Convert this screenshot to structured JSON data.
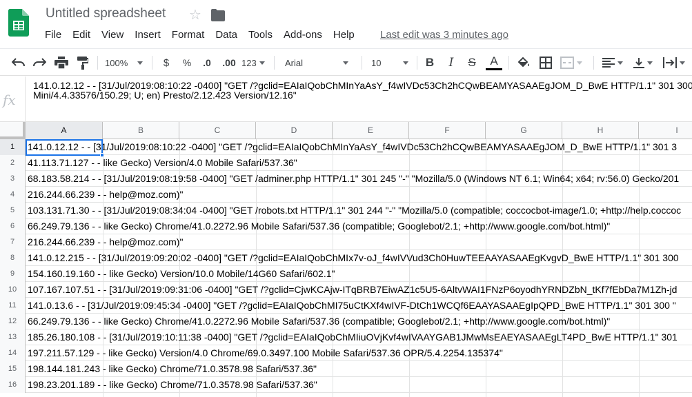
{
  "app": {
    "title": "Untitled spreadsheet",
    "last_edit": "Last edit was 3 minutes ago",
    "brand_color": "#0f9d58"
  },
  "menu": [
    "File",
    "Edit",
    "View",
    "Insert",
    "Format",
    "Data",
    "Tools",
    "Add-ons",
    "Help"
  ],
  "toolbar": {
    "zoom": "100%",
    "currency": "$",
    "percent": "%",
    "decimal_decrease": ".0",
    "decimal_increase": ".00",
    "number_format": "123",
    "font": "Arial",
    "font_size": "10",
    "bold": "B",
    "italic": "I",
    "strikethrough": "S",
    "text_color": "A",
    "text_color_swatch": "#000000"
  },
  "formula_bar": {
    "fx": "fx",
    "content": "141.0.12.12 - - [31/Jul/2019:08:10:22 -0400] \"GET /?gclid=EAIaIQobChMInYaAsY_f4wIVDc53Ch2hCQwBEAMYASAAEgJOM_D_BwE HTTP/1.1\" 301 300\nMini/4.4.33576/150.29; U; en) Presto/2.12.423 Version/12.16\""
  },
  "columns": [
    "A",
    "B",
    "C",
    "D",
    "E",
    "F",
    "G",
    "H",
    "I"
  ],
  "selected_cell": "A1",
  "rows": [
    {
      "num": "1",
      "text": "141.0.12.12 - - [31/Jul/2019:08:10:22 -0400] \"GET /?gclid=EAIaIQobChMInYaAsY_f4wIVDc53Ch2hCQwBEAMYASAAEgJOM_D_BwE HTTP/1.1\" 301 3"
    },
    {
      "num": "2",
      "text": "41.113.71.127 - - like Gecko) Version/4.0 Mobile Safari/537.36\""
    },
    {
      "num": "3",
      "text": "68.183.58.214 - - [31/Jul/2019:08:19:58 -0400] \"GET /adminer.php HTTP/1.1\" 301 245 \"-\" \"Mozilla/5.0 (Windows NT 6.1; Win64; x64; rv:56.0) Gecko/201"
    },
    {
      "num": "4",
      "text": "216.244.66.239 - - help@moz.com)\""
    },
    {
      "num": "5",
      "text": "103.131.71.30 - - [31/Jul/2019:08:34:04 -0400] \"GET /robots.txt HTTP/1.1\" 301 244 \"-\" \"Mozilla/5.0 (compatible; coccocbot-image/1.0; +http://help.coccoc"
    },
    {
      "num": "6",
      "text": "66.249.79.136 - - like Gecko) Chrome/41.0.2272.96 Mobile Safari/537.36 (compatible; Googlebot/2.1; +http://www.google.com/bot.html)\""
    },
    {
      "num": "7",
      "text": "216.244.66.239 - - help@moz.com)\""
    },
    {
      "num": "8",
      "text": "141.0.12.215 - - [31/Jul/2019:09:20:02 -0400] \"GET /?gclid=EAIaIQobChMIx7v-oJ_f4wIVVud3Ch0HuwTEEAAYASAAEgKvgvD_BwE HTTP/1.1\" 301 300"
    },
    {
      "num": "9",
      "text": "154.160.19.160 - - like Gecko) Version/10.0 Mobile/14G60 Safari/602.1\""
    },
    {
      "num": "10",
      "text": "107.167.107.51 - - [31/Jul/2019:09:31:06 -0400] \"GET /?gclid=CjwKCAjw-ITqBRB7EiwAZ1c5U5-6AltvWAI1FNzP6oyodhYRNDZbN_tKf7fEbDa7M1Zh-jd"
    },
    {
      "num": "11",
      "text": "141.0.13.6 - - [31/Jul/2019:09:45:34 -0400] \"GET /?gclid=EAIaIQobChMI75uCtKXf4wIVF-DtCh1WCQf6EAAYASAAEgIpQPD_BwE HTTP/1.1\" 301 300 \""
    },
    {
      "num": "12",
      "text": "66.249.79.136 - - like Gecko) Chrome/41.0.2272.96 Mobile Safari/537.36 (compatible; Googlebot/2.1; +http://www.google.com/bot.html)\""
    },
    {
      "num": "13",
      "text": "185.26.180.108 - - [31/Jul/2019:10:11:38 -0400] \"GET /?gclid=EAIaIQobChMIiuOVjKvf4wIVAAYGAB1JMwMsEAEYASAAEgLT4PD_BwE HTTP/1.1\" 301"
    },
    {
      "num": "14",
      "text": "197.211.57.129 - - like Gecko) Version/4.0 Chrome/69.0.3497.100 Mobile Safari/537.36 OPR/5.4.2254.135374\""
    },
    {
      "num": "15",
      "text": "198.144.181.243 - like Gecko) Chrome/71.0.3578.98 Safari/537.36\""
    },
    {
      "num": "16",
      "text": "198.23.201.189 - - like Gecko) Chrome/71.0.3578.98 Safari/537.36\""
    }
  ]
}
